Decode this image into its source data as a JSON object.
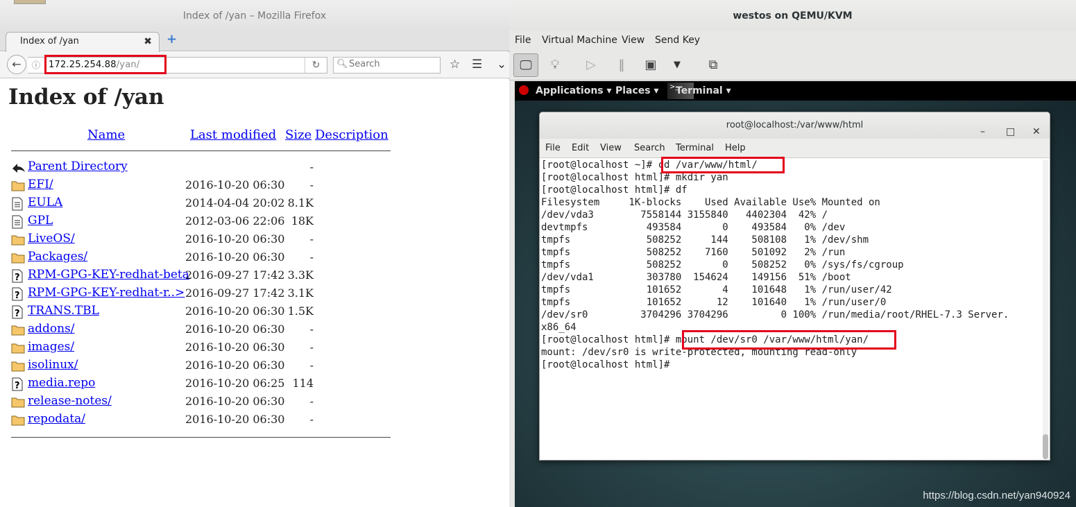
{
  "firefox": {
    "window_title": "Index of /yan – Mozilla Firefox",
    "tab_label": "Index of /yan",
    "tab_close": "✖",
    "new_tab": "+",
    "url_host": "172.25.254.88",
    "url_path": "/yan/",
    "search_placeholder": "Search",
    "page_title": "Index of /yan",
    "columns": [
      "Name",
      "Last modified",
      "Size",
      "Description"
    ],
    "rows": [
      {
        "icon": "back-icon",
        "name": "Parent Directory",
        "modified": "",
        "size": "-"
      },
      {
        "icon": "folder-icon",
        "name": "EFI/",
        "modified": "2016-10-20 06:30",
        "size": "-"
      },
      {
        "icon": "text-file-icon",
        "name": "EULA",
        "modified": "2014-04-04 20:02",
        "size": "8.1K"
      },
      {
        "icon": "text-file-icon",
        "name": "GPL",
        "modified": "2012-03-06 22:06",
        "size": "18K"
      },
      {
        "icon": "folder-icon",
        "name": "LiveOS/",
        "modified": "2016-10-20 06:30",
        "size": "-"
      },
      {
        "icon": "folder-icon",
        "name": "Packages/",
        "modified": "2016-10-20 06:30",
        "size": "-"
      },
      {
        "icon": "unknown-file-icon",
        "name": "RPM-GPG-KEY-redhat-beta",
        "modified": "2016-09-27 17:42",
        "size": "3.3K"
      },
      {
        "icon": "unknown-file-icon",
        "name": "RPM-GPG-KEY-redhat-r..>",
        "modified": "2016-09-27 17:42",
        "size": "3.1K"
      },
      {
        "icon": "unknown-file-icon",
        "name": "TRANS.TBL",
        "modified": "2016-10-20 06:30",
        "size": "1.5K"
      },
      {
        "icon": "folder-icon",
        "name": "addons/",
        "modified": "2016-10-20 06:30",
        "size": "-"
      },
      {
        "icon": "folder-icon",
        "name": "images/",
        "modified": "2016-10-20 06:30",
        "size": "-"
      },
      {
        "icon": "folder-icon",
        "name": "isolinux/",
        "modified": "2016-10-20 06:30",
        "size": "-"
      },
      {
        "icon": "unknown-file-icon",
        "name": "media.repo",
        "modified": "2016-10-20 06:25",
        "size": "114"
      },
      {
        "icon": "folder-icon",
        "name": "release-notes/",
        "modified": "2016-10-20 06:30",
        "size": "-"
      },
      {
        "icon": "folder-icon",
        "name": "repodata/",
        "modified": "2016-10-20 06:30",
        "size": "-"
      }
    ]
  },
  "qemu": {
    "window_title": "westos on QEMU/KVM",
    "menu": [
      "File",
      "Virtual Machine",
      "View",
      "Send Key"
    ],
    "gnome_panel": {
      "applications": "Applications ▾",
      "places": "Places ▾",
      "terminal": "Terminal ▾"
    },
    "terminal": {
      "title": "root@localhost:/var/www/html",
      "menu": [
        "File",
        "Edit",
        "View",
        "Search",
        "Terminal",
        "Help"
      ],
      "lines": [
        "[root@localhost ~]# cd /var/www/html/",
        "[root@localhost html]# mkdir yan",
        "[root@localhost html]# df",
        "Filesystem     1K-blocks    Used Available Use% Mounted on",
        "/dev/vda3        7558144 3155840   4402304  42% /",
        "devtmpfs          493584       0    493584   0% /dev",
        "tmpfs             508252     144    508108   1% /dev/shm",
        "tmpfs             508252    7160    501092   2% /run",
        "tmpfs             508252       0    508252   0% /sys/fs/cgroup",
        "/dev/vda1         303780  154624    149156  51% /boot",
        "tmpfs             101652       4    101648   1% /run/user/42",
        "tmpfs             101652      12    101640   1% /run/user/0",
        "/dev/sr0         3704296 3704296         0 100% /run/media/root/RHEL-7.3 Server.",
        "x86_64",
        "[root@localhost html]# mount /dev/sr0 /var/www/html/yan/",
        "mount: /dev/sr0 is write-protected, mounting read-only",
        "[root@localhost html]#"
      ]
    }
  },
  "watermark": "https://blog.csdn.net/yan940924",
  "colors": {
    "highlight": "#e3001b",
    "link": "#0000ee"
  }
}
